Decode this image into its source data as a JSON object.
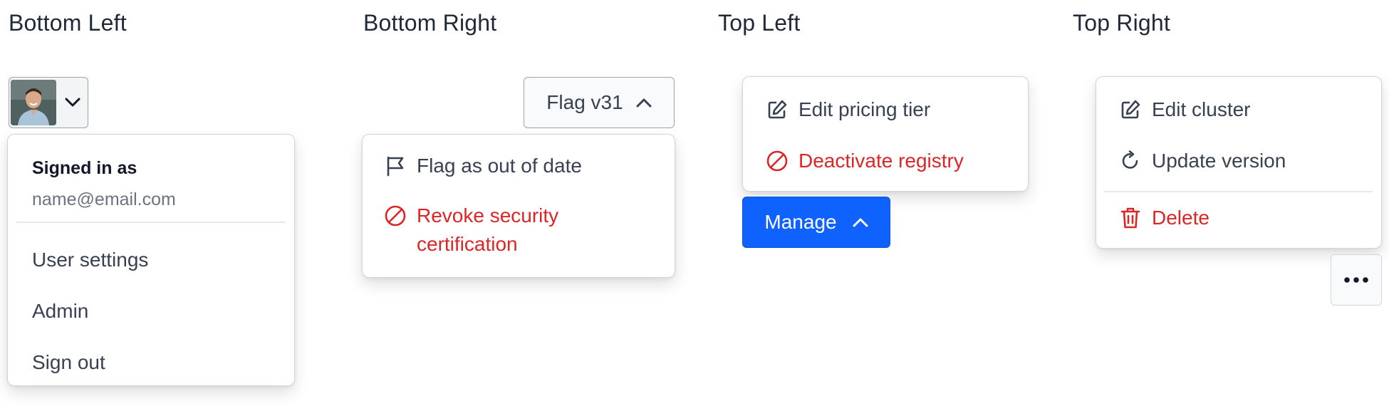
{
  "sections": {
    "bottom_left": {
      "title": "Bottom Left"
    },
    "bottom_right": {
      "title": "Bottom Right"
    },
    "top_left": {
      "title": "Top Left"
    },
    "top_right": {
      "title": "Top Right"
    }
  },
  "user_menu": {
    "signed_in_label": "Signed in as",
    "email": "name@email.com",
    "items": [
      {
        "label": "User settings"
      },
      {
        "label": "Admin"
      },
      {
        "label": "Sign out"
      }
    ]
  },
  "flag_menu": {
    "button_label": "Flag v31",
    "items": [
      {
        "label": "Flag as out of date",
        "icon": "flag-icon"
      },
      {
        "label": "Revoke security certification",
        "icon": "ban-icon",
        "danger": true
      }
    ]
  },
  "manage_menu": {
    "button_label": "Manage",
    "items": [
      {
        "label": "Edit pricing tier",
        "icon": "edit-icon"
      },
      {
        "label": "Deactivate registry",
        "icon": "ban-icon",
        "danger": true
      }
    ]
  },
  "cluster_menu": {
    "items": [
      {
        "label": "Edit cluster",
        "icon": "edit-icon"
      },
      {
        "label": "Update version",
        "icon": "refresh-icon"
      },
      {
        "label": "Delete",
        "icon": "trash-icon",
        "danger": true
      }
    ],
    "overflow_icon": "ellipsis-icon"
  },
  "colors": {
    "primary": "#0f62fe",
    "danger": "#dc2626",
    "text": "#374151",
    "border": "#d1d5db"
  }
}
